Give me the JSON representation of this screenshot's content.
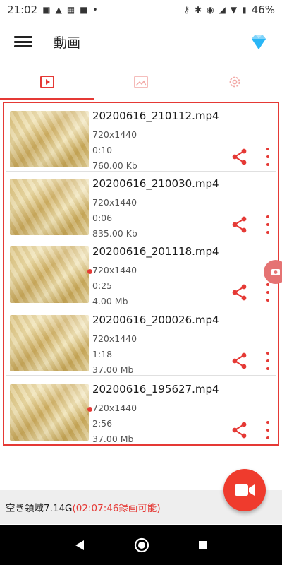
{
  "status_bar": {
    "time": "21:02",
    "battery": "46%"
  },
  "app_bar": {
    "title": "動画"
  },
  "tabs": [
    {
      "name": "video",
      "icon": "video-tab-icon",
      "active": true
    },
    {
      "name": "image",
      "icon": "image-tab-icon",
      "active": false
    },
    {
      "name": "settings",
      "icon": "settings-tab-icon",
      "active": false
    }
  ],
  "videos": [
    {
      "filename": "20200616_210112.mp4",
      "resolution": "720x1440",
      "duration": "0:10",
      "size": "760.00 Kb"
    },
    {
      "filename": "20200616_210030.mp4",
      "resolution": "720x1440",
      "duration": "0:06",
      "size": "835.00 Kb"
    },
    {
      "filename": "20200616_201118.mp4",
      "resolution": "720x1440",
      "duration": "0:25",
      "size": "4.00 Mb"
    },
    {
      "filename": "20200616_200026.mp4",
      "resolution": "720x1440",
      "duration": "1:18",
      "size": "37.00 Mb"
    },
    {
      "filename": "20200616_195627.mp4",
      "resolution": "720x1440",
      "duration": "2:56",
      "size": "37.00 Mb"
    }
  ],
  "storage": {
    "free_label": "空き領域7.14G",
    "record_time": "(02:07:46録画可能)"
  },
  "colors": {
    "accent": "#e53935",
    "fab": "#ef3b2d"
  }
}
